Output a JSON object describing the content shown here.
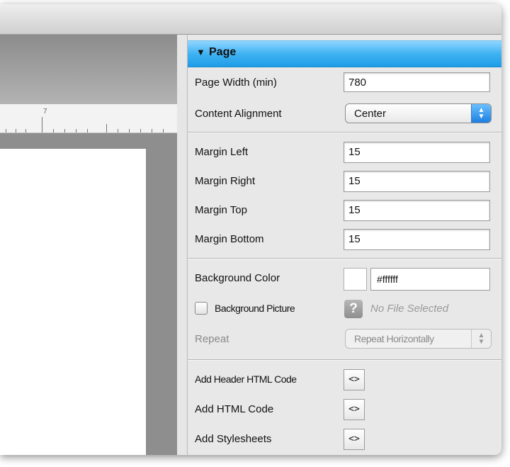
{
  "ruler": {
    "mark": "7"
  },
  "panel": {
    "title": "Page",
    "disclosure_glyph": "▼",
    "page_width": {
      "label": "Page Width (min)",
      "value": "780"
    },
    "content_alignment": {
      "label": "Content Alignment",
      "value": "Center"
    },
    "margins": [
      {
        "label": "Margin Left",
        "value": "15"
      },
      {
        "label": "Margin Right",
        "value": "15"
      },
      {
        "label": "Margin Top",
        "value": "15"
      },
      {
        "label": "Margin Bottom",
        "value": "15"
      }
    ],
    "background_color": {
      "label": "Background Color",
      "value": "#ffffff",
      "swatch": "#ffffff"
    },
    "background_picture": {
      "label": "Background Picture",
      "checked": false,
      "help_glyph": "?",
      "file_status": "No File Selected"
    },
    "repeat": {
      "label": "Repeat",
      "value": "Repeat Horizontally"
    },
    "code_items": [
      {
        "label": "Add Header HTML Code",
        "button": "<>"
      },
      {
        "label": "Add HTML Code",
        "button": "<>"
      },
      {
        "label": "Add Stylesheets",
        "button": "<>"
      }
    ]
  },
  "colors": {
    "header_accent": "#3fb2f2",
    "panel_bg": "#e8e8e8",
    "canvas_gray": "#8e8e8e"
  }
}
